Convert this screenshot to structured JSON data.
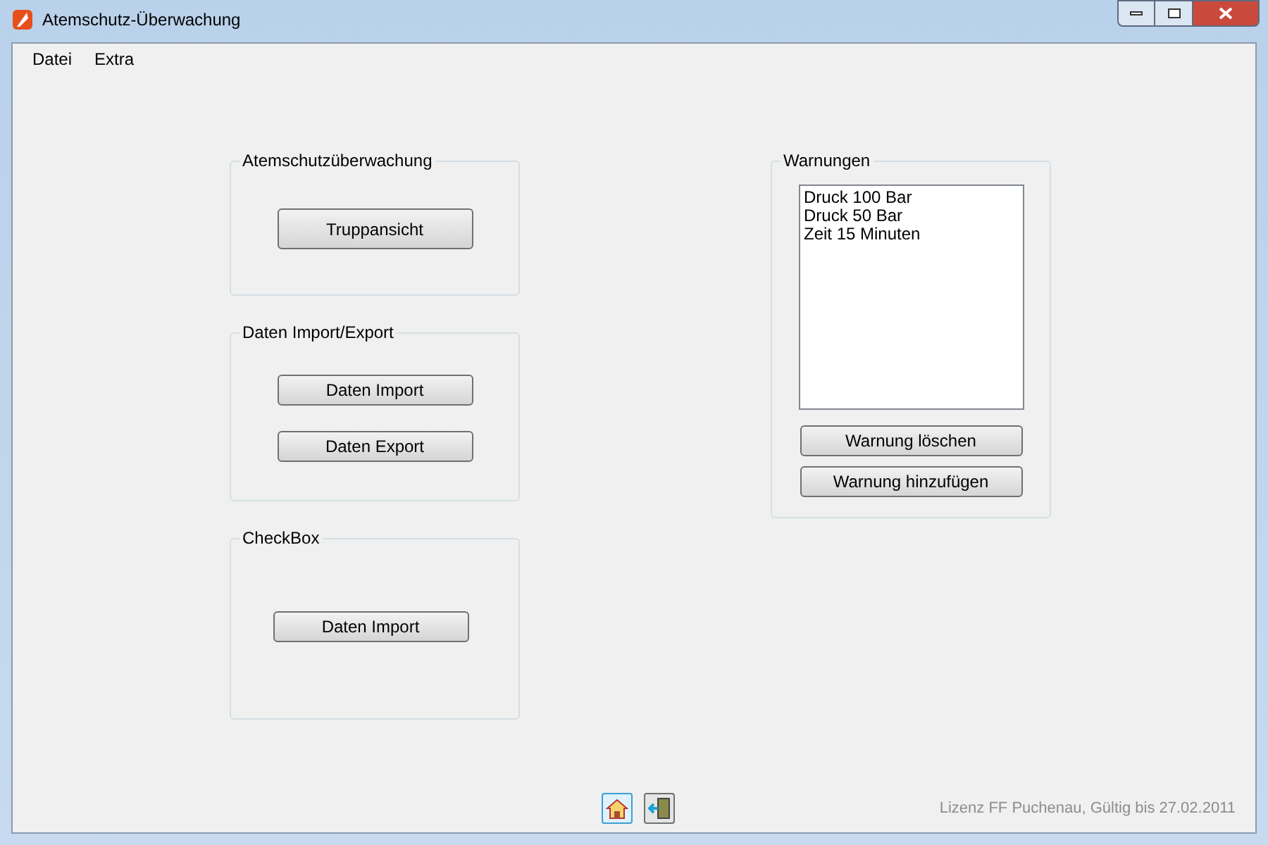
{
  "window": {
    "title": "Atemschutz-Überwachung"
  },
  "menu": [
    "Datei",
    "Extra"
  ],
  "groups": [
    {
      "title": "Atemschutzüberwachung",
      "buttons": [
        "Truppansicht"
      ]
    },
    {
      "title": "Daten Import/Export",
      "buttons": [
        "Daten Import",
        "Daten Export"
      ]
    },
    {
      "title": "CheckBox",
      "buttons": [
        "Daten Import"
      ]
    }
  ],
  "warnings": {
    "title": "Warnungen",
    "items": [
      "Druck 100 Bar",
      "Druck 50 Bar",
      "Zeit 15 Minuten"
    ],
    "buttons": [
      "Warnung löschen",
      "Warnung hinzufügen"
    ]
  },
  "toolbar": [
    {
      "kind": "home",
      "selected": true
    },
    {
      "kind": "exit",
      "selected": false
    }
  ],
  "status": "Lizenz FF Puchenau, Gültig bis 27.02.2011"
}
